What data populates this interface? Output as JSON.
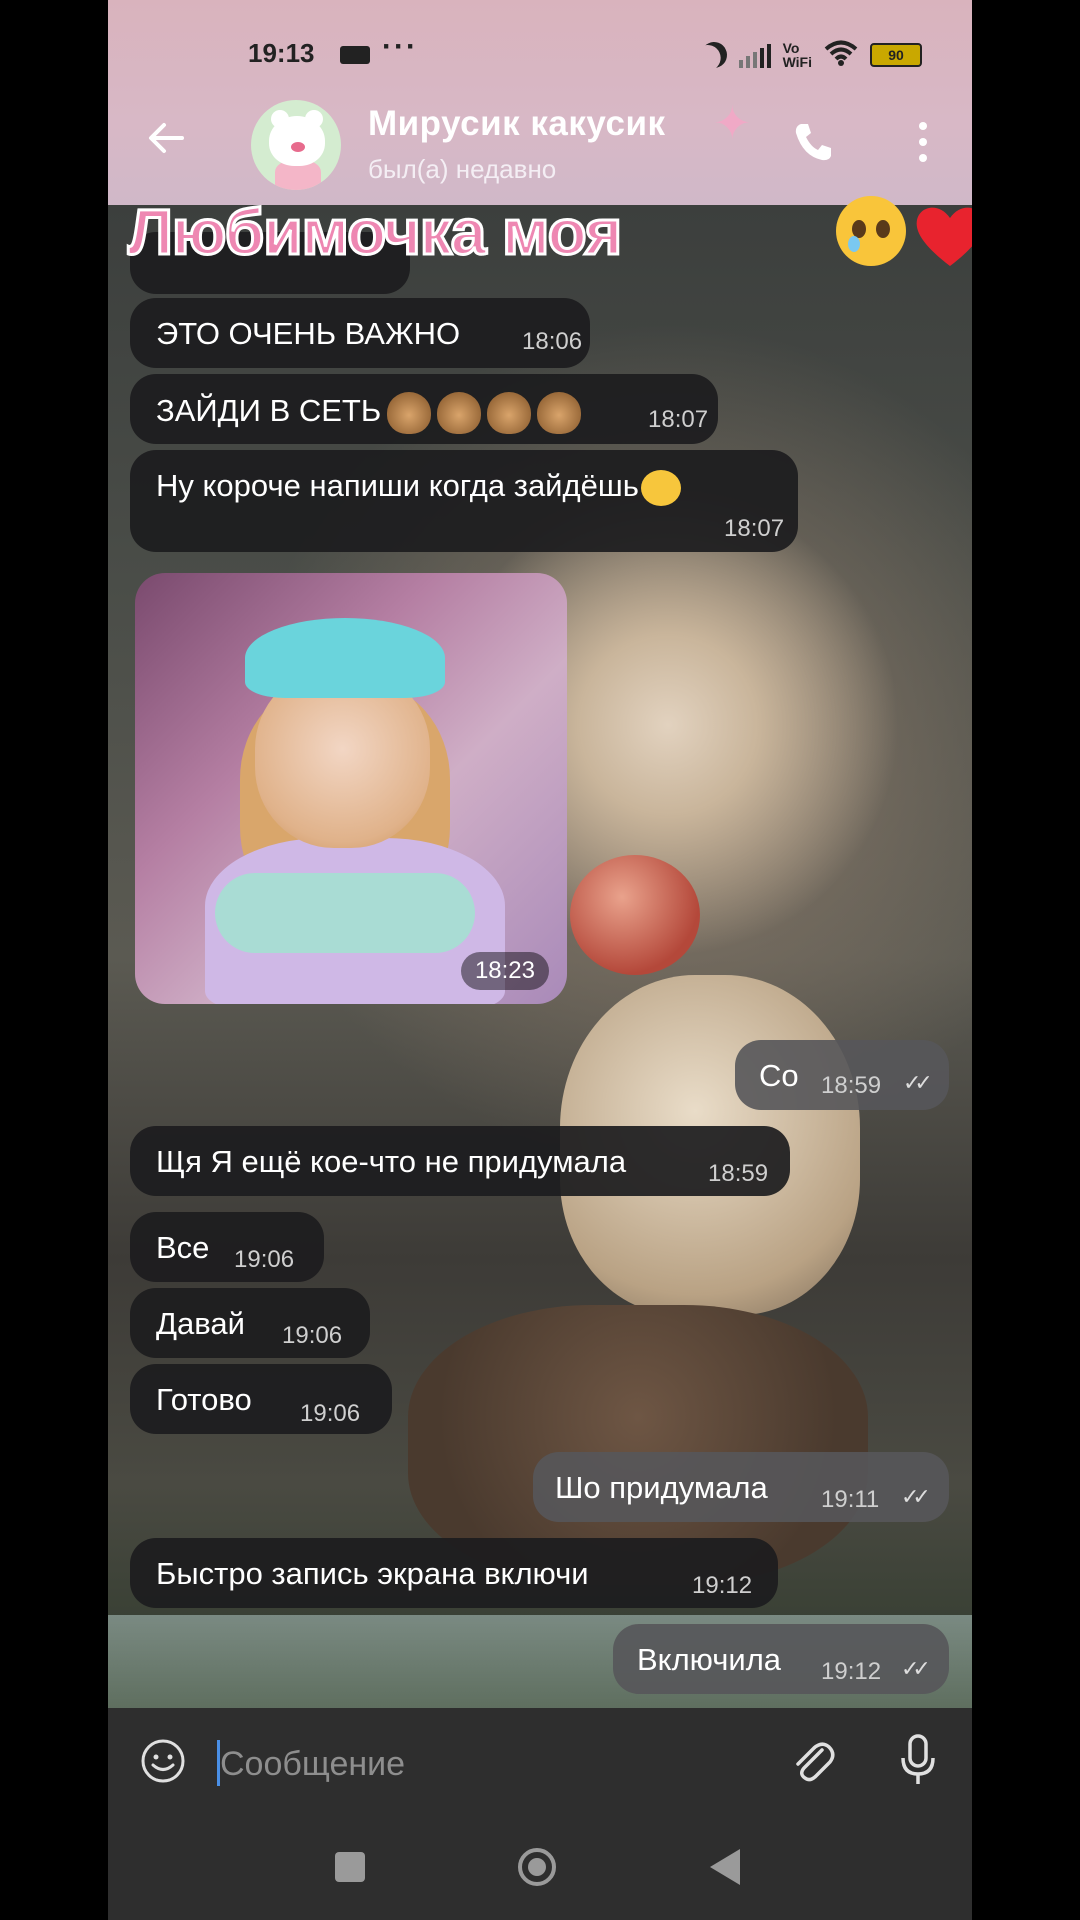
{
  "status_bar": {
    "time": "19:13",
    "dots": "···",
    "vowifi": "Vo\nWiFi",
    "battery": "90"
  },
  "header": {
    "name": "Мирусик какусик",
    "status": "был(а) недавно",
    "icons": {
      "back": "back-arrow-icon",
      "call": "phone-icon",
      "menu": "more-vertical-icon"
    }
  },
  "overlay_banner": {
    "text": "Любимочка моя"
  },
  "messages": [
    {
      "id": "m1",
      "direction": "in",
      "text": "ЭТО ОЧЕНЬ ВАЖНО",
      "time": "18:06"
    },
    {
      "id": "m2",
      "direction": "in",
      "text": "ЗАЙДИ В СЕТЬ",
      "time": "18:07"
    },
    {
      "id": "m3",
      "direction": "in",
      "text": "Ну короче напиши когда зайдёшь",
      "time": "18:07"
    },
    {
      "id": "m4",
      "direction": "in",
      "type": "photo",
      "time": "18:23"
    },
    {
      "id": "m5",
      "direction": "out",
      "text": "Со",
      "time": "18:59"
    },
    {
      "id": "m6",
      "direction": "in",
      "text": "Щя Я ещё кое-что не придумала",
      "time": "18:59"
    },
    {
      "id": "m7",
      "direction": "in",
      "text": "Все",
      "time": "19:06"
    },
    {
      "id": "m8",
      "direction": "in",
      "text": "Давай",
      "time": "19:06"
    },
    {
      "id": "m9",
      "direction": "in",
      "text": "Готово",
      "time": "19:06"
    },
    {
      "id": "m10",
      "direction": "out",
      "text": "Шо придумала",
      "time": "19:11"
    },
    {
      "id": "m11",
      "direction": "in",
      "text": "Быстро запись экрана включи",
      "time": "19:12"
    },
    {
      "id": "m12",
      "direction": "out",
      "text": "Включила",
      "time": "19:12"
    }
  ],
  "input": {
    "placeholder": "Сообщение"
  },
  "colors": {
    "header_bg": "#d9b3bd",
    "bubble_in": "#1c1c1e",
    "bubble_out": "#56565a",
    "banner_text": "#ee87b2",
    "caret": "#4a8fe6"
  }
}
